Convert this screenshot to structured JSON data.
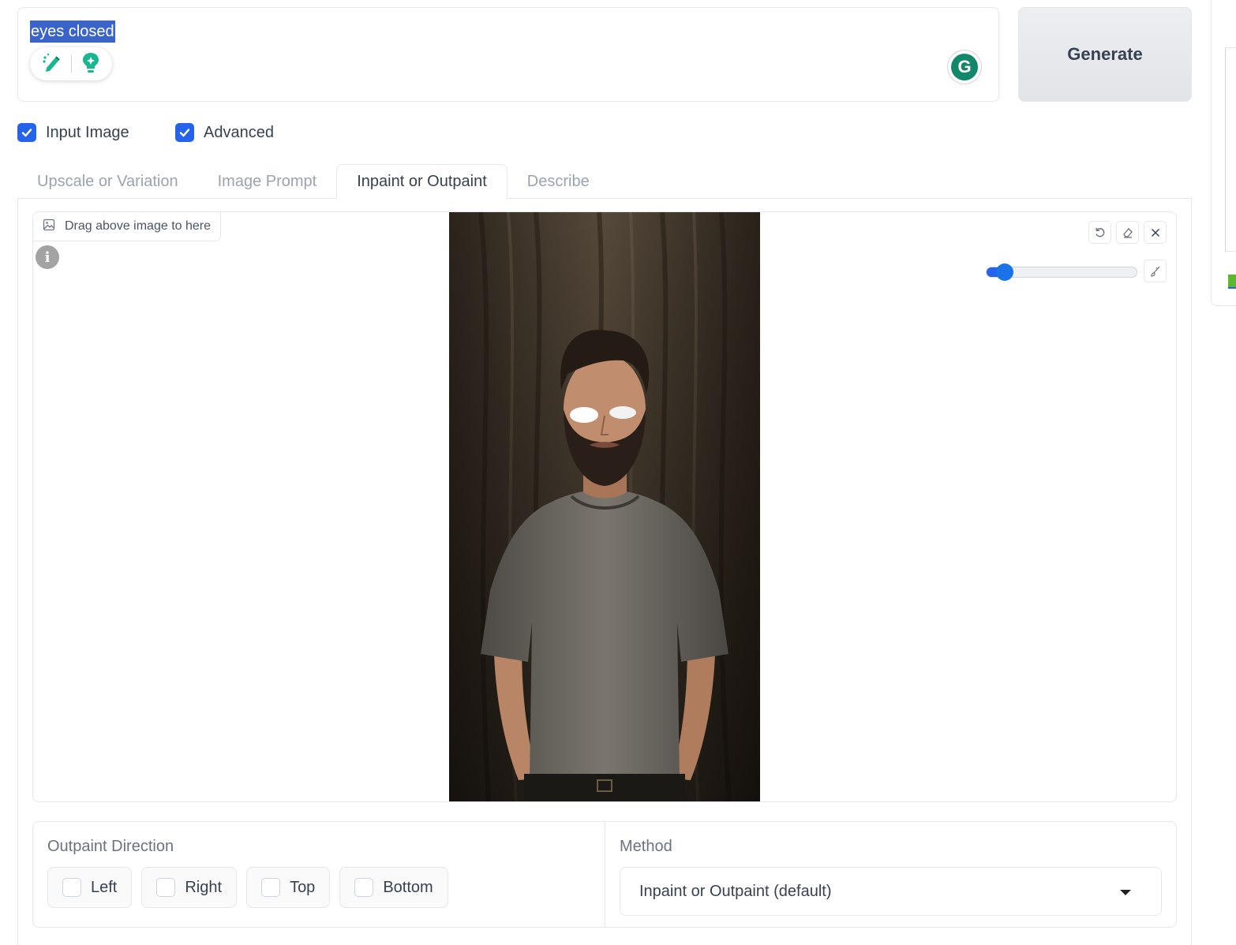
{
  "prompt": {
    "text": "eyes closed"
  },
  "generate_label": "Generate",
  "toggles": {
    "input_image_label": "Input Image",
    "advanced_label": "Advanced"
  },
  "tabs": [
    {
      "label": "Upscale or Variation"
    },
    {
      "label": "Image Prompt"
    },
    {
      "label": "Inpaint or Outpaint"
    },
    {
      "label": "Describe"
    }
  ],
  "active_tab": "Inpaint or Outpaint",
  "editor": {
    "drag_hint": "Drag above image to here",
    "brush_size_fraction": 0.12
  },
  "outpaint": {
    "label": "Outpaint Direction",
    "options": [
      {
        "label": "Left"
      },
      {
        "label": "Right"
      },
      {
        "label": "Top"
      },
      {
        "label": "Bottom"
      }
    ]
  },
  "method": {
    "label": "Method",
    "selected": "Inpaint or Outpaint (default)"
  },
  "colors": {
    "accent": "#2563eb",
    "selection": "#3b64c8",
    "grammarly": "#13876a"
  }
}
